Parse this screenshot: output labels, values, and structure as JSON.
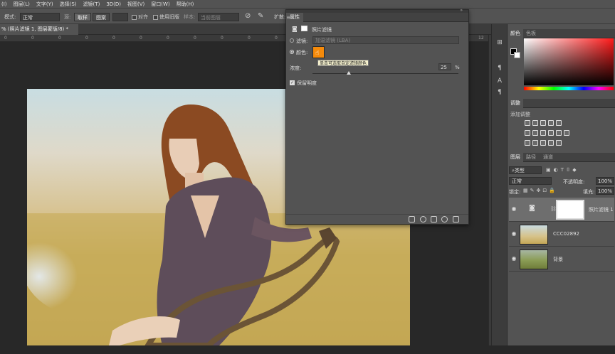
{
  "menu": [
    "(I)",
    "图层(L)",
    "文字(Y)",
    "选择(S)",
    "滤镜(T)",
    "3D(D)",
    "视图(V)",
    "窗口(W)",
    "帮助(H)"
  ],
  "options": {
    "mode_label": "模式:",
    "mode_value": "正常",
    "source_label": "源:",
    "sampled_btn": "取样",
    "pattern_btn": "图案",
    "aligned_label": "对齐",
    "legacy_label": "使用旧版",
    "sample_label": "样本:",
    "sample_value": "当前图层",
    "diffusion_label": "扩散:"
  },
  "document": {
    "tab_title": "% (照片滤镜 1, 图层蒙版/8) *",
    "ruler_ticks": [
      "0",
      "0",
      "0",
      "0",
      "0",
      "0",
      "0",
      "0",
      "0",
      "0",
      "0",
      "0",
      "0",
      "0",
      "0",
      "0",
      "12"
    ]
  },
  "properties": {
    "tab": "属性",
    "panel_name": "照片滤镜",
    "filter_label": "滤镜:",
    "filter_value": "加温滤镜 (LBA)",
    "color_label": "颜色:",
    "tooltip": "单击可选取自定滤镜颜色",
    "density_label": "浓度:",
    "density_value": "25",
    "density_unit": "%",
    "density": 25,
    "preserve_label": "保留明度",
    "swatch_color": "#f58a0a"
  },
  "color_panel": {
    "tabs": [
      "颜色",
      "色板"
    ]
  },
  "adjust_panel": {
    "tab": "调整",
    "add_label": "添加调整"
  },
  "layers_panel": {
    "tabs": [
      "图层",
      "路径",
      "通道"
    ],
    "kind_label": "类型",
    "blend_mode": "正常",
    "opacity_label": "不透明度:",
    "opacity_value": "100%",
    "lock_label": "锁定:",
    "fill_label": "填充:",
    "fill_value": "100%",
    "layers": [
      {
        "name": "照片滤镜 1"
      },
      {
        "name": "CCC02892"
      },
      {
        "name": "背景"
      }
    ]
  }
}
